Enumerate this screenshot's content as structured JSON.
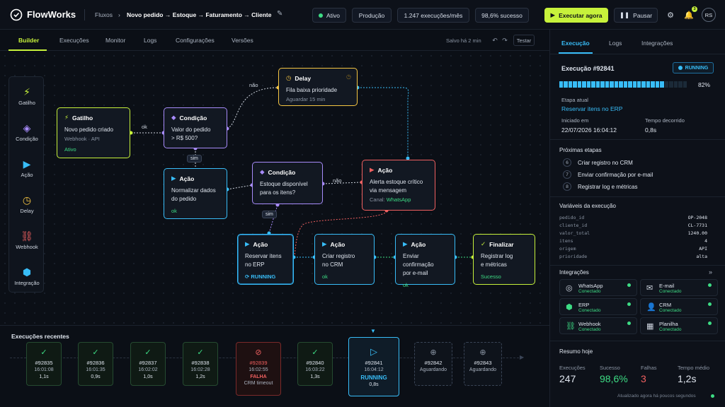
{
  "header": {
    "brand": "FlowWorks",
    "breadcrumb_root": "Fluxos",
    "breadcrumb_current": "Novo pedido → Estoque → Faturamento → Cliente",
    "status": "Ativo",
    "environment": "Produção",
    "executions": "1.247 execuções/mês",
    "success_rate": "98,6% sucesso",
    "run_label": "Executar agora",
    "pause_label": "Pausar",
    "notif_count": "3",
    "avatar": "RS",
    "colors": {
      "accent": "#c7f23b",
      "info": "#38bdf8",
      "success": "#3ddc84",
      "danger": "#f06060"
    }
  },
  "tabs": {
    "items": [
      "Builder",
      "Execuções",
      "Monitor",
      "Logs",
      "Configurações",
      "Versões"
    ],
    "saved": "Salvo há 2 min",
    "test": "Testar"
  },
  "palette": [
    {
      "label": "Gatilho",
      "icon": "bolt-icon"
    },
    {
      "label": "Condição",
      "icon": "diamond-icon"
    },
    {
      "label": "Ação",
      "icon": "play-icon"
    },
    {
      "label": "Delay",
      "icon": "clock-icon"
    },
    {
      "label": "Webhook",
      "icon": "link-icon"
    },
    {
      "label": "Integração",
      "icon": "cube-icon"
    }
  ],
  "nodes": {
    "trigger": {
      "type": "Gatilho",
      "line1": "Novo pedido criado",
      "sub": "Webhook · API",
      "status": "Ativo"
    },
    "cond1": {
      "type": "Condição",
      "line1": "Valor do pedido",
      "line2": "> R$ 500?"
    },
    "delay": {
      "type": "Delay",
      "line1": "Fila baixa prioridade",
      "sub": "Aguardar 15 min"
    },
    "act_normalize": {
      "type": "Ação",
      "line1": "Normalizar dados",
      "line2": "do pedido",
      "status": "ok"
    },
    "cond2": {
      "type": "Condição",
      "line1": "Estoque disponível",
      "line2": "para os itens?"
    },
    "act_alert": {
      "type": "Ação",
      "line1": "Alerta estoque crítico",
      "line2": "via mensagem",
      "sub_prefix": "Canal:",
      "sub_value": "WhatsApp"
    },
    "act_reserve": {
      "type": "Ação",
      "line1": "Reservar itens",
      "line2": "no ERP",
      "status": "RUNNING"
    },
    "act_crm": {
      "type": "Ação",
      "line1": "Criar registro",
      "line2": "no CRM",
      "status": "ok"
    },
    "act_email": {
      "type": "Ação",
      "line1": "Enviar confirmação",
      "line2": "por e-mail",
      "status": "ok"
    },
    "finish": {
      "type": "Finalizar",
      "line1": "Registrar log",
      "line2": "e métricas",
      "status": "Sucesso"
    }
  },
  "edges": {
    "ok": "ok",
    "nao1": "não",
    "sim1": "sim",
    "nao2": "não",
    "sim2": "sim"
  },
  "recent": {
    "title": "Execuções recentes",
    "items": [
      {
        "id": "#92835",
        "time": "16:01:08",
        "dur": "1,1s",
        "state": "ok"
      },
      {
        "id": "#92836",
        "time": "16:01:35",
        "dur": "0,9s",
        "state": "ok"
      },
      {
        "id": "#92837",
        "time": "16:02:02",
        "dur": "1,0s",
        "state": "ok"
      },
      {
        "id": "#92838",
        "time": "16:02:28",
        "dur": "1,2s",
        "state": "ok"
      },
      {
        "id": "#92839",
        "time": "16:02:55",
        "dur": "FALHA",
        "note": "CRM timeout",
        "state": "fail"
      },
      {
        "id": "#92840",
        "time": "16:03:22",
        "dur": "1,3s",
        "state": "ok"
      },
      {
        "id": "#92841",
        "time": "16:04:12",
        "dur": "RUNNING",
        "note": "0,8s",
        "state": "run"
      },
      {
        "id": "#92842",
        "time": "Aguardando",
        "state": "wait"
      },
      {
        "id": "#92843",
        "time": "Aguardando",
        "state": "wait"
      }
    ]
  },
  "panel": {
    "tabs": [
      "Execução",
      "Logs",
      "Integrações"
    ],
    "exec_title": "Execução #92841",
    "exec_status": "RUNNING",
    "progress": 82,
    "progress_label": "82%",
    "current_step_label": "Etapa atual",
    "current_step": "Reservar itens no ERP",
    "started_label": "Iniciado em",
    "started": "22/07/2026 16:04:12",
    "elapsed_label": "Tempo decorrido",
    "elapsed": "0,8s",
    "next_title": "Próximas etapas",
    "next_steps": [
      {
        "n": "6",
        "label": "Criar registro no CRM"
      },
      {
        "n": "7",
        "label": "Enviar confirmação por e-mail"
      },
      {
        "n": "8",
        "label": "Registrar log e métricas"
      }
    ],
    "vars_title": "Variáveis da execução",
    "vars": [
      {
        "k": "pedido_id",
        "v": "OP-2048"
      },
      {
        "k": "cliente_id",
        "v": "CL-7731"
      },
      {
        "k": "valor_total",
        "v": "1240.00"
      },
      {
        "k": "itens",
        "v": "4"
      },
      {
        "k": "origem",
        "v": "API"
      },
      {
        "k": "prioridade",
        "v": "alta"
      }
    ],
    "integ_title": "Integrações",
    "integrations": [
      {
        "name": "WhatsApp",
        "status": "Conectado",
        "icon": "whatsapp-icon"
      },
      {
        "name": "E-mail",
        "status": "Conectado",
        "icon": "mail-icon"
      },
      {
        "name": "ERP",
        "status": "Conectado",
        "icon": "cube-icon"
      },
      {
        "name": "CRM",
        "status": "Conectado",
        "icon": "person-icon"
      },
      {
        "name": "Webhook",
        "status": "Conectado",
        "icon": "link-icon"
      },
      {
        "name": "Planilha",
        "status": "Conectado",
        "icon": "grid-icon"
      }
    ],
    "summary_title": "Resumo hoje",
    "summary": [
      {
        "label": "Execuções",
        "value": "247"
      },
      {
        "label": "Sucesso",
        "value": "98,6%"
      },
      {
        "label": "Falhas",
        "value": "3"
      },
      {
        "label": "Tempo médio",
        "value": "1,2s"
      }
    ],
    "updated": "Atualizado agora há poucos segundos"
  }
}
